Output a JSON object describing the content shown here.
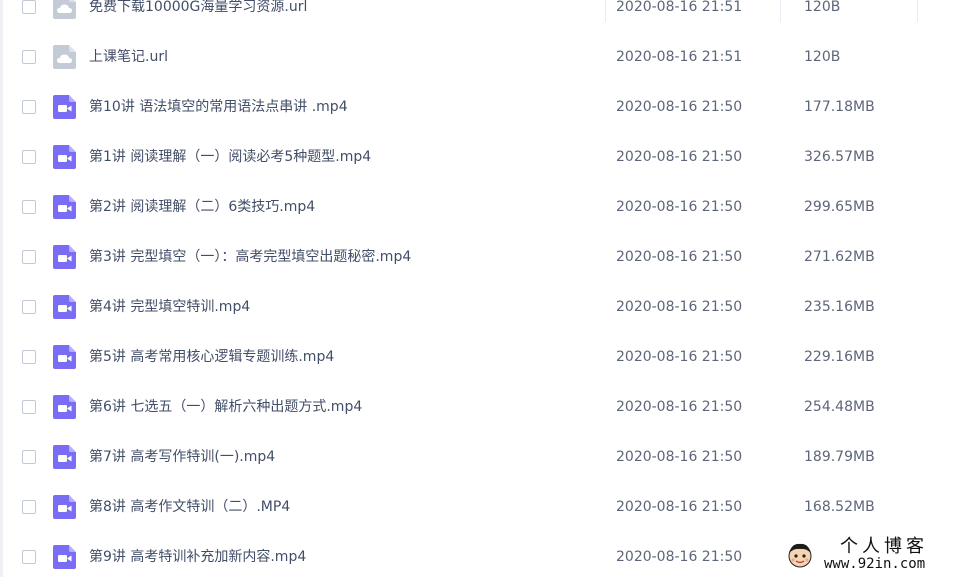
{
  "files": [
    {
      "name": "免费下载10000G海量学习资源.url",
      "date": "2020-08-16 21:51",
      "size": "120B",
      "type": "link"
    },
    {
      "name": "上课笔记.url",
      "date": "2020-08-16 21:51",
      "size": "120B",
      "type": "link"
    },
    {
      "name": "第10讲 语法填空的常用语法点串讲 .mp4",
      "date": "2020-08-16 21:50",
      "size": "177.18MB",
      "type": "video"
    },
    {
      "name": "第1讲 阅读理解（一）阅读必考5种题型.mp4",
      "date": "2020-08-16 21:50",
      "size": "326.57MB",
      "type": "video"
    },
    {
      "name": "第2讲 阅读理解（二）6类技巧.mp4",
      "date": "2020-08-16 21:50",
      "size": "299.65MB",
      "type": "video"
    },
    {
      "name": "第3讲 完型填空（一）：高考完型填空出题秘密.mp4",
      "date": "2020-08-16 21:50",
      "size": "271.62MB",
      "type": "video"
    },
    {
      "name": "第4讲 完型填空特训.mp4",
      "date": "2020-08-16 21:50",
      "size": "235.16MB",
      "type": "video"
    },
    {
      "name": "第5讲 高考常用核心逻辑专题训练.mp4",
      "date": "2020-08-16 21:50",
      "size": "229.16MB",
      "type": "video"
    },
    {
      "name": "第6讲 七选五（一）解析六种出题方式.mp4",
      "date": "2020-08-16 21:50",
      "size": "254.48MB",
      "type": "video"
    },
    {
      "name": "第7讲 高考写作特训(一).mp4",
      "date": "2020-08-16 21:50",
      "size": "189.79MB",
      "type": "video"
    },
    {
      "name": "第8讲 高考作文特训（二）.MP4",
      "date": "2020-08-16 21:50",
      "size": "168.52MB",
      "type": "video"
    },
    {
      "name": "第9讲 高考特训补充加新内容.mp4",
      "date": "2020-08-16 21:50",
      "size": "",
      "type": "video"
    }
  ],
  "icons": {
    "link": {
      "name": "cloud-link-file-icon",
      "color": "#c4cbd6"
    },
    "video": {
      "name": "video-file-icon",
      "color": "#7b6cf6"
    }
  },
  "watermark": {
    "title": "个人博客",
    "url": "www.92in.com"
  },
  "colors": {
    "text": "#424e67",
    "meta": "#5d6679",
    "checkbox_border": "#c3c9d4"
  }
}
